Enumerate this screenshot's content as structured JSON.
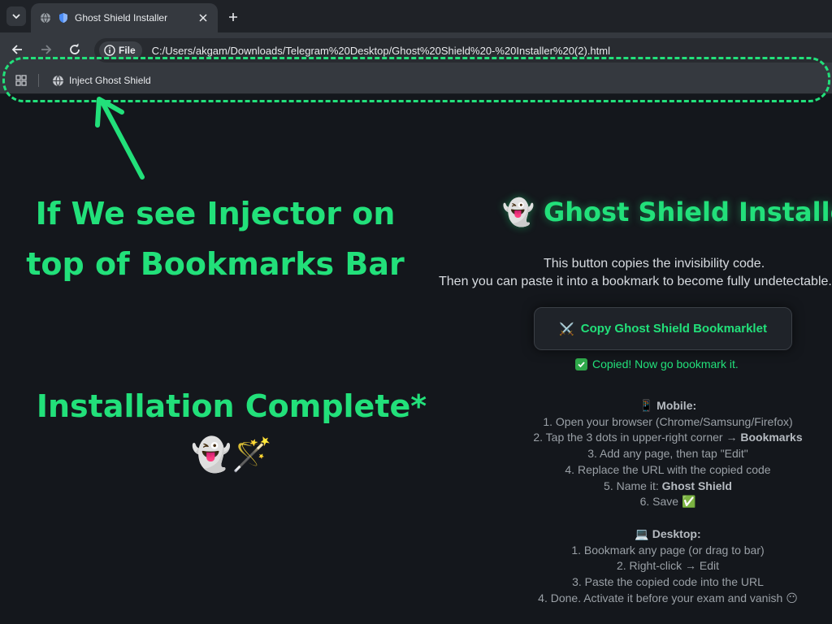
{
  "browser": {
    "tab_title": "Ghost Shield Installer",
    "new_tab_symbol": "+",
    "security_chip_label": "File",
    "url": "C:/Users/akgam/Downloads/Telegram%20Desktop/Ghost%20Shield%20-%20Installer%20(2).html",
    "bookmark_label": "Inject Ghost Shield"
  },
  "annotations": {
    "injector_note_line1": "If We see Injector on",
    "injector_note_line2": "top of Bookmarks Bar",
    "install_complete": "Installation Complete*",
    "install_emoji": "👻🪄"
  },
  "installer": {
    "title_emoji": "👻",
    "title": "Ghost Shield Installer",
    "desc_line1": "This button copies the invisibility code.",
    "desc_line2": "Then you can paste it into a bookmark to become fully undetectable.",
    "copy_button_emoji": "⚔️",
    "copy_button_label": "Copy Ghost Shield Bookmarklet",
    "copied_message": "Copied! Now go bookmark it."
  },
  "mobile": {
    "emoji": "📱",
    "heading": "Mobile:",
    "step1": "1. Open your browser (Chrome/Samsung/Firefox)",
    "step2_pre": "2. Tap the 3 dots in upper-right corner → ",
    "step2_bold": "Bookmarks",
    "step3": "3. Add any page, then tap \"Edit\"",
    "step4": "4. Replace the URL with the copied code",
    "step5_pre": "5. Name it: ",
    "step5_bold": "Ghost Shield",
    "step6": "6. Save ✅"
  },
  "desktop": {
    "emoji": "💻",
    "heading": "Desktop:",
    "step1": "1. Bookmark any page (or drag to bar)",
    "step2": "2. Right-click → Edit",
    "step3": "3. Paste the copied code into the URL",
    "step4": "4. Done. Activate it before your exam and vanish 😶"
  },
  "colors": {
    "accent_green": "#22e07a",
    "background": "#14171c",
    "chrome_toolbar": "#35393f"
  }
}
